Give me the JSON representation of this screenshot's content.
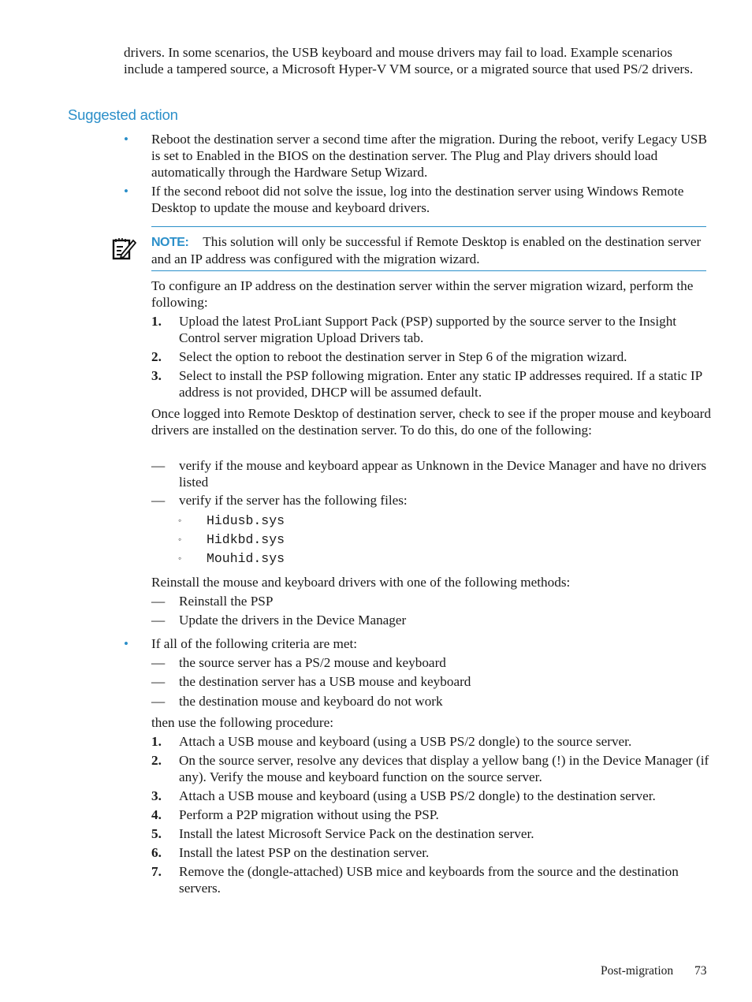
{
  "intro_text": "drivers. In some scenarios, the USB keyboard and mouse drivers may fail to load. Example scenarios include a tampered source, a Microsoft Hyper-V VM source, or a migrated source that used PS/2 drivers.",
  "section_heading": "Suggested action",
  "colors": {
    "accent": "#2b8fc9",
    "text": "#1a1a1a"
  },
  "bullets_top": [
    "Reboot the destination server a second time after the migration. During the reboot, verify Legacy USB is set to Enabled in the BIOS on the destination server. The Plug and Play drivers should load automatically through the Hardware Setup Wizard.",
    "If the second reboot did not solve the issue, log into the destination server using Windows Remote Desktop to update the mouse and keyboard drivers."
  ],
  "note": {
    "icon": "note-pencil-icon",
    "label": "NOTE:",
    "text": "This solution will only be successful if Remote Desktop is enabled on the destination server and an IP address was configured with the migration wizard."
  },
  "configure_intro": "To configure an IP address on the destination server within the server migration wizard, perform the following:",
  "configure_steps": [
    {
      "num": "1.",
      "text": "Upload the latest ProLiant Support Pack (PSP) supported by the source server to the Insight Control server migration Upload Drivers tab."
    },
    {
      "num": "2.",
      "text": "Select the option to reboot the destination server in Step 6 of the migration wizard."
    },
    {
      "num": "3.",
      "text": "Select to install the PSP following migration. Enter any static IP addresses required. If a static IP address is not provided, DHCP will be assumed default."
    }
  ],
  "check_intro": "Once logged into Remote Desktop of destination server, check to see if the proper mouse and keyboard drivers are installed on the destination server. To do this, do one of the following:",
  "check_items": [
    "verify if the mouse and keyboard appear as Unknown in the Device Manager and have no drivers listed",
    "verify if the server has the following files:"
  ],
  "files": [
    "Hidusb.sys",
    "Hidkbd.sys",
    "Mouhid.sys"
  ],
  "reinstall_intro": "Reinstall the mouse and keyboard drivers with one of the following methods:",
  "reinstall_methods": [
    "Reinstall the PSP",
    "Update the drivers in the Device Manager"
  ],
  "bullet_criteria": "If all of the following criteria are met:",
  "criteria": [
    "the source server has a PS/2 mouse and keyboard",
    "the destination server has a USB mouse and keyboard",
    "the destination mouse and keyboard do not work"
  ],
  "procedure_intro": "then use the following procedure:",
  "procedure_steps": [
    {
      "num": "1.",
      "text": "Attach a USB mouse and keyboard (using a USB PS/2 dongle) to the source server."
    },
    {
      "num": "2.",
      "text": "On the source server, resolve any devices that display a yellow bang (!) in the Device Manager (if any). Verify the mouse and keyboard function on the source server."
    },
    {
      "num": "3.",
      "text": "Attach a USB mouse and keyboard (using a USB PS/2 dongle) to the destination server."
    },
    {
      "num": "4.",
      "text": "Perform a P2P migration without using the PSP."
    },
    {
      "num": "5.",
      "text": "Install the latest Microsoft Service Pack on the destination server."
    },
    {
      "num": "6.",
      "text": "Install the latest PSP on the destination server."
    },
    {
      "num": "7.",
      "text": "Remove the (dongle-attached) USB mice and keyboards from the source and the destination servers."
    }
  ],
  "bullet_glyph": "•",
  "dash_glyph": "—",
  "circle_glyph": "◦",
  "footer": {
    "section": "Post-migration",
    "page": "73"
  }
}
